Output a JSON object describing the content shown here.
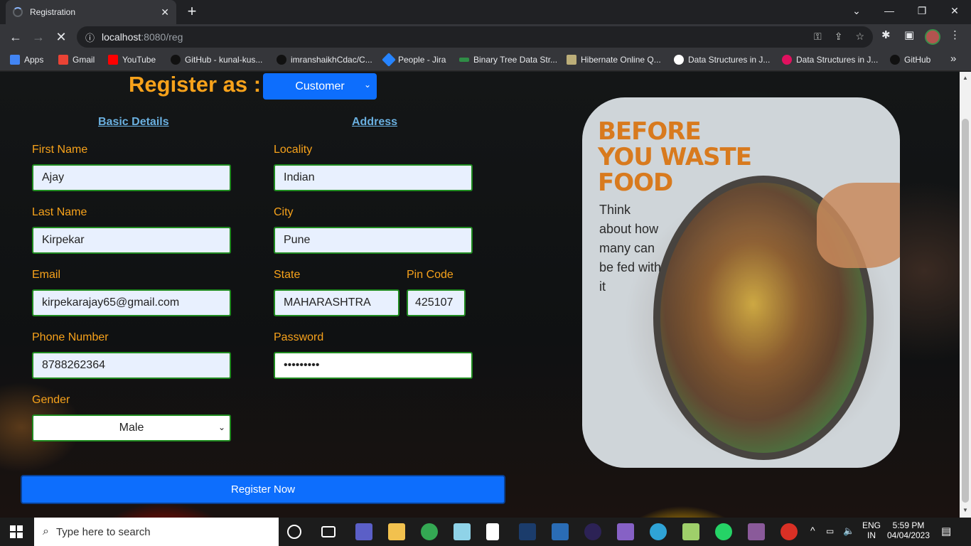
{
  "browser": {
    "tab_title": "Registration",
    "tab_close": "✕",
    "new_tab": "+",
    "url_host": "localhost",
    "url_path": ":8080/reg",
    "window": {
      "minimize": "—",
      "restore": "❐",
      "close": "✕",
      "tabsearch": "⌄"
    },
    "bookmarks": [
      {
        "label": "Apps",
        "icon": "apps-grid-icon",
        "color": "#4285f4"
      },
      {
        "label": "Gmail",
        "icon": "gmail-icon",
        "color": "#ea4335"
      },
      {
        "label": "YouTube",
        "icon": "youtube-icon",
        "color": "#ff0000"
      },
      {
        "label": "GitHub - kunal-kus...",
        "icon": "github-icon",
        "color": "#000000"
      },
      {
        "label": "imranshaikhCdac/C...",
        "icon": "github-icon",
        "color": "#000000"
      },
      {
        "label": "People - Jira",
        "icon": "jira-icon",
        "color": "#2684ff"
      },
      {
        "label": "Binary Tree Data Str...",
        "icon": "gfg-icon",
        "color": "#2f8d46"
      },
      {
        "label": "Hibernate Online Q...",
        "icon": "hibernate-icon",
        "color": "#bcae79"
      },
      {
        "label": "Data Structures in J...",
        "icon": "google-icon",
        "color": "#ffffff"
      },
      {
        "label": "Data Structures in J...",
        "icon": "tcoder-icon",
        "color": "#e0115f"
      },
      {
        "label": "GitHub",
        "icon": "github-icon",
        "color": "#000000"
      }
    ],
    "bookmarks_more": "»"
  },
  "form": {
    "register_as_label": "Register as :",
    "role_selected": "Customer",
    "section_basic": "Basic Details",
    "section_address": "Address",
    "first_name_label": "First Name",
    "first_name_value": "Ajay",
    "last_name_label": "Last Name",
    "last_name_value": "Kirpekar",
    "email_label": "Email",
    "email_value": "kirpekarajay65@gmail.com",
    "phone_label": "Phone Number",
    "phone_value": "8788262364",
    "gender_label": "Gender",
    "gender_selected": "Male",
    "locality_label": "Locality",
    "locality_value": "Indian",
    "city_label": "City",
    "city_value": "Pune",
    "state_label": "State",
    "state_value": "MAHARASHTRA",
    "pincode_label": "Pin Code",
    "pincode_value": "425107",
    "password_label": "Password",
    "password_value": "•••••••••",
    "submit_label": "Register Now"
  },
  "promo": {
    "headline_1": "BEFORE",
    "headline_2": "YOU WASTE",
    "headline_3": "FOOD",
    "tagline": "Think about how many can be fed with it"
  },
  "taskbar": {
    "search_placeholder": "Type here to search",
    "lang_1": "ENG",
    "lang_2": "IN",
    "time": "5:59 PM",
    "date": "04/04/2023"
  },
  "colors": {
    "accent_orange": "#f7a21b",
    "primary_blue": "#0d6efd",
    "input_border_green": "#1f8a1f",
    "link_blue": "#6ab0e0"
  }
}
